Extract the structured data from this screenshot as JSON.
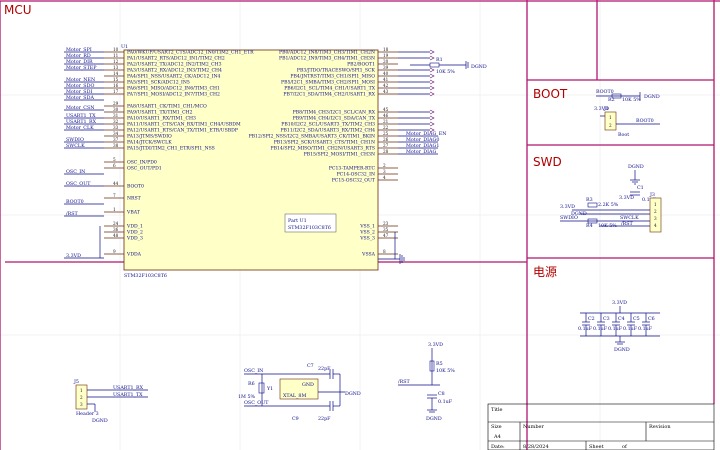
{
  "sections": {
    "mcu": "MCU",
    "boot": "BOOT",
    "swd": "SWD",
    "power": "电源"
  },
  "mcu": {
    "designator": "U1",
    "part_line1": "Part U1",
    "part_line2": "STM32F103C8T6",
    "footer_label": "STM32F103C8T6",
    "left_nets": [
      "Motor_SPI",
      "Motor_RD",
      "Motor_DIR",
      "Motor_STEP",
      "Motor_NEN",
      "Motor_SDO",
      "Motor_SDI",
      "Motor_SDA",
      "",
      "Motor_CSN",
      "USART1_TX",
      "USART1_RX",
      "Motor_CLK",
      "",
      "SWDIO",
      "SWCLK",
      "",
      "OSC_IN",
      "OSC_OUT",
      "",
      "BOOT0",
      "",
      "/RST",
      "",
      "",
      "",
      "",
      "",
      "3.3VD"
    ],
    "left_pins": [
      {
        "num": "10",
        "name": "PA0/WKUP/USART2_CTS/ADC12_IN0/TIM2_CH1_ETR"
      },
      {
        "num": "11",
        "name": "PA1/USART2_RTS/ADC12_IN1/TIM2_CH2"
      },
      {
        "num": "12",
        "name": "PA2/USART2_TX/ADC12_IN2/TIM2_CH3"
      },
      {
        "num": "13",
        "name": "PA3/USART2_RX/ADC12_IN3/TIM2_CH4"
      },
      {
        "num": "14",
        "name": "PA4/SPI1_NSS/USART2_CK/ADC12_IN4"
      },
      {
        "num": "15",
        "name": "PA5/SPI1_SCK/ADC12_IN5"
      },
      {
        "num": "16",
        "name": "PA6/SPI1_MISO/ADC12_IN6/TIM3_CH1"
      },
      {
        "num": "17",
        "name": "PA7/SPI1_MOSI/ADC12_IN7/TIM3_CH2"
      },
      {
        "num": "29",
        "name": "PA8/USART1_CK/TIM1_CH1/MCO"
      },
      {
        "num": "30",
        "name": "PA9/USART1_TX/TIM1_CH2"
      },
      {
        "num": "31",
        "name": "PA10/USART1_RX/TIM1_CH3"
      },
      {
        "num": "32",
        "name": "PA11/USART1_CTS/CAN_RX/TIM1_CH4/USBDM"
      },
      {
        "num": "33",
        "name": "PA12/USART1_RTS/CAN_TX/TIM1_ETR/USBDP"
      },
      {
        "num": "34",
        "name": "PA13/JTMS/SWDIO"
      },
      {
        "num": "37",
        "name": "PA14/JTCK/SWCLK"
      },
      {
        "num": "38",
        "name": "PA15/JTDI/TIM2_CH1_ETR/SPI1_NSS"
      },
      {
        "num": "5",
        "name": "OSC_IN/PD0"
      },
      {
        "num": "6",
        "name": "OSC_OUT/PD1"
      },
      {
        "num": "44",
        "name": "BOOT0"
      },
      {
        "num": "7",
        "name": "NRST"
      },
      {
        "num": "1",
        "name": "VBAT"
      },
      {
        "num": "24",
        "name": "VDD_1"
      },
      {
        "num": "36",
        "name": "VDD_2"
      },
      {
        "num": "48",
        "name": "VDD_3"
      },
      {
        "num": "9",
        "name": "VDDA"
      }
    ],
    "right_pins": [
      {
        "num": "18",
        "name": "PB0/ADC12_IN8/TIM3_CH3/TIM1_CH2N"
      },
      {
        "num": "19",
        "name": "PB1/ADC12_IN9/TIM3_CH4/TIM1_CH3N"
      },
      {
        "num": "20",
        "name": "PB2/BOOT1"
      },
      {
        "num": "39",
        "name": "PB3/JTDO/TRACESWO/SPI1_SCK"
      },
      {
        "num": "40",
        "name": "PB4/JNTRST/TIM3_CH1/SPI1_MISO"
      },
      {
        "num": "41",
        "name": "PB5/I2C1_SMBA/TIM3_CH2/SPI1_MOSI"
      },
      {
        "num": "42",
        "name": "PB6/I2C1_SCL/TIM4_CH1/USART1_TX"
      },
      {
        "num": "43",
        "name": "PB7/I2C1_SDA/TIM4_CH2/USART1_RX"
      },
      {
        "num": "45",
        "name": "PB8/TIM4_CH3/I2C1_SCL/CAN_RX"
      },
      {
        "num": "46",
        "name": "PB9/TIM4_CH4/I2C1_SDA/CAN_TX"
      },
      {
        "num": "21",
        "name": "PB10/I2C2_SCL/USART3_TX/TIM2_CH3"
      },
      {
        "num": "22",
        "name": "PB11/I2C2_SDA/USART3_RX/TIM2_CH4"
      },
      {
        "num": "25",
        "name": "PB12/SPI2_NSS/I2C2_SMBA/USART3_CK/TIM1_BKIN"
      },
      {
        "num": "26",
        "name": "PB13/SPI2_SCK/USART3_CTS/TIM1_CH1N"
      },
      {
        "num": "27",
        "name": "PB14/SPI2_MISO/TIM1_CH2N/USART3_RTS"
      },
      {
        "num": "28",
        "name": "PB15/SPI2_MOSI/TIM1_CH3N"
      },
      {
        "num": "2",
        "name": "PC13-TAMPER-RTC"
      },
      {
        "num": "3",
        "name": "PC14-OSC32_IN"
      },
      {
        "num": "4",
        "name": "PC15-OSC32_OUT"
      },
      {
        "num": "23",
        "name": "VSS_1"
      },
      {
        "num": "35",
        "name": "VSS_2"
      },
      {
        "num": "47",
        "name": "VSS_3"
      },
      {
        "num": "8",
        "name": "VSSA"
      }
    ],
    "right_nets": [
      "",
      "",
      "",
      "",
      "",
      "",
      "",
      "",
      "",
      "",
      "Motor_DIAG_EN",
      "Motor_DIAG0",
      "Motor_DIAG1",
      "Motor_DIAG"
    ],
    "r1": {
      "ref": "R1",
      "value": "10K 5%",
      "net": "DGND"
    }
  },
  "boot": {
    "net": "BOOT0",
    "r2": {
      "ref": "R2",
      "value": "10K 5%"
    },
    "gnd": "DGND",
    "j1": {
      "ref": "J1",
      "value": "Boot"
    },
    "boot0_label": "BOOT0",
    "vcc": "3.3VD"
  },
  "swd": {
    "gnd": "DGND",
    "c1": {
      "ref": "C1",
      "value": "0.1uF"
    },
    "vcc1": "3.3VD",
    "vcc2": "3.3VD",
    "r3": {
      "ref": "R3",
      "value": "2.2K 5%"
    },
    "r4": {
      "ref": "R4",
      "value": "10K 5%"
    },
    "gnd2": "DGND",
    "nets": [
      "SWDIO",
      "SWCLK",
      "/RST"
    ],
    "j3": {
      "ref": "J3"
    }
  },
  "power": {
    "vcc": "3.3VD",
    "caps": [
      {
        "ref": "C2",
        "value": "0.1uF"
      },
      {
        "ref": "C3",
        "value": "0.1uF"
      },
      {
        "ref": "C4",
        "value": "0.1uF"
      },
      {
        "ref": "C5",
        "value": "0.1uF"
      },
      {
        "ref": "C6",
        "value": "0.1uF"
      }
    ],
    "gnd": "DGND"
  },
  "uart": {
    "j5": {
      "ref": "J5",
      "value": "Header 3"
    },
    "nets": [
      "USART1_RX",
      "USART1_TX"
    ],
    "gnd": "DGND"
  },
  "crystal": {
    "osc_in": "OSC_IN",
    "osc_out": "OSC_OUT",
    "y1": {
      "ref": "Y1",
      "value": "XTAL_8M"
    },
    "r": {
      "ref": "R6",
      "value": "1M 5%"
    },
    "c7": {
      "ref": "C7",
      "value": "22pF"
    },
    "c8": {
      "ref": "C9",
      "value": "22pF"
    },
    "gnd_label": "GND",
    "gnd": "DGND"
  },
  "reset": {
    "vcc": "3.3VD",
    "r5": {
      "ref": "R5",
      "value": "10K 5%"
    },
    "rst": "/RST",
    "c8": {
      "ref": "C8",
      "value": "0.1uF"
    },
    "gnd": "DGND"
  },
  "title_block": {
    "title_label": "Title",
    "size_label": "Size",
    "size_value": "A4",
    "number_label": "Number",
    "revision_label": "Revision",
    "date_label": "Date:",
    "date_value": "8/28/2024",
    "sheet_label": "Sheet",
    "of_label": "of"
  },
  "colors": {
    "border": "#b0166e",
    "section_text": "#b00000",
    "wire": "#0d0d8a",
    "pin": "#6a2a0a",
    "chip_fill": "#ffffc8"
  }
}
